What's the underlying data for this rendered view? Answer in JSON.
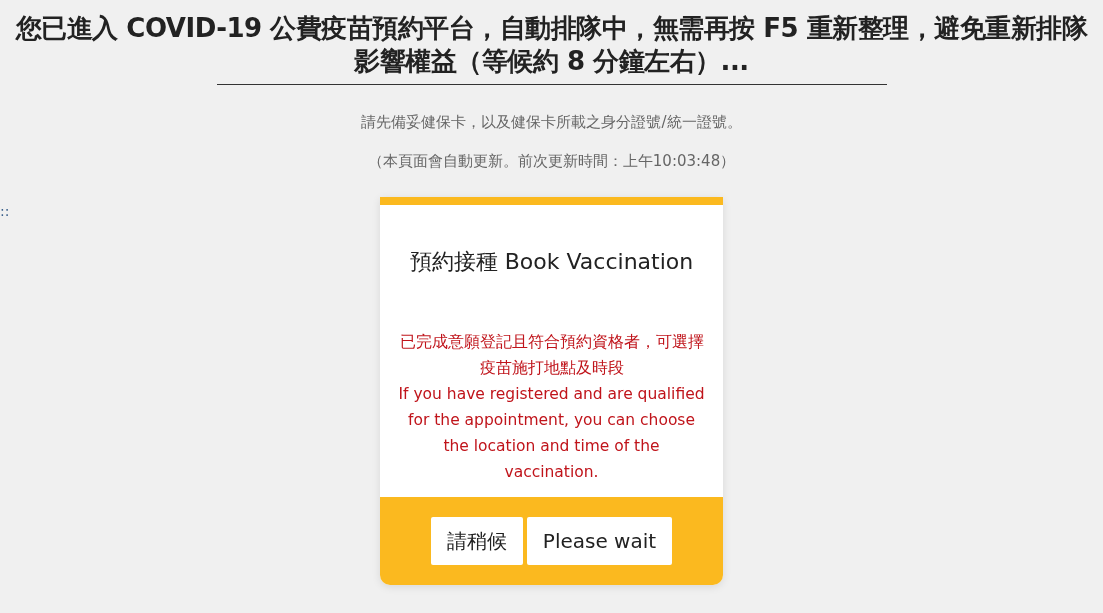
{
  "heading": "您已進入 COVID-19 公費疫苗預約平台，自動排隊中，無需再按 F5 重新整理，避免重新排隊影響權益（等候約 8 分鐘左右）...",
  "instruction": "請先備妥健保卡，以及健保卡所載之身分證號/統一證號。",
  "update_note": "（本頁面會自動更新。前次更新時間：上午10:03:48）",
  "side_marker": "::",
  "card": {
    "title": "預約接種 Book Vaccination",
    "notice_zh": "已完成意願登記且符合預約資格者，可選擇疫苗施打地點及時段",
    "notice_en": "If you have registered and are qualified for the appointment, you can choose the location and time of the vaccination.",
    "buttons": [
      "請稍候",
      "Please wait"
    ]
  }
}
